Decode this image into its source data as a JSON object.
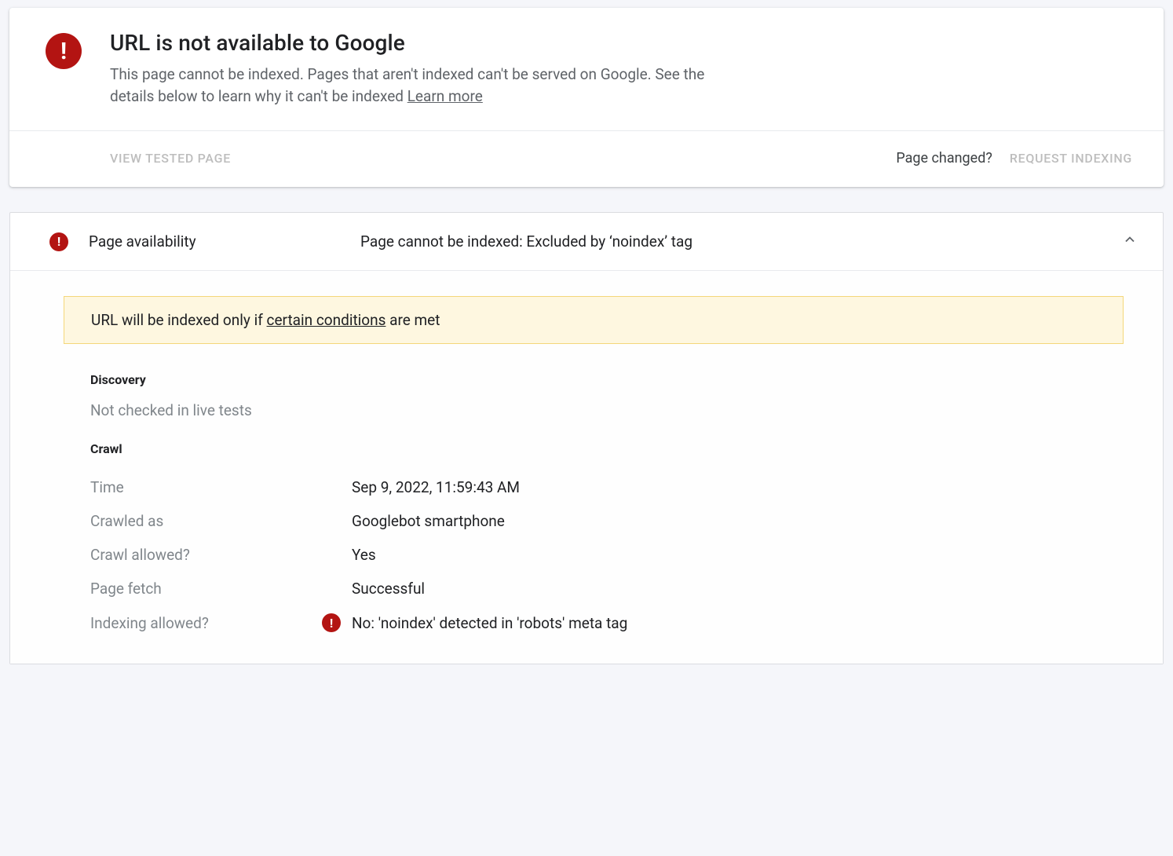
{
  "header": {
    "title": "URL is not available to Google",
    "description_before": "This page cannot be indexed. Pages that aren't indexed can't be served on Google. See the details below to learn why it can't be indexed ",
    "learn_more": "Learn more"
  },
  "actions": {
    "view_tested_page": "VIEW TESTED PAGE",
    "page_changed": "Page changed?",
    "request_indexing": "REQUEST INDEXING"
  },
  "availability": {
    "section_title": "Page availability",
    "status": "Page cannot be indexed: Excluded by ‘noindex’ tag",
    "notice_before": "URL will be indexed only if ",
    "notice_link": "certain conditions",
    "notice_after": " are met",
    "discovery_heading": "Discovery",
    "discovery_text": "Not checked in live tests",
    "crawl_heading": "Crawl",
    "crawl": {
      "time_label": "Time",
      "time_value": "Sep 9, 2022, 11:59:43 AM",
      "crawled_as_label": "Crawled as",
      "crawled_as_value": "Googlebot smartphone",
      "crawl_allowed_label": "Crawl allowed?",
      "crawl_allowed_value": "Yes",
      "page_fetch_label": "Page fetch",
      "page_fetch_value": "Successful",
      "indexing_allowed_label": "Indexing allowed?",
      "indexing_allowed_value": "No: 'noindex' detected in 'robots' meta tag"
    }
  }
}
